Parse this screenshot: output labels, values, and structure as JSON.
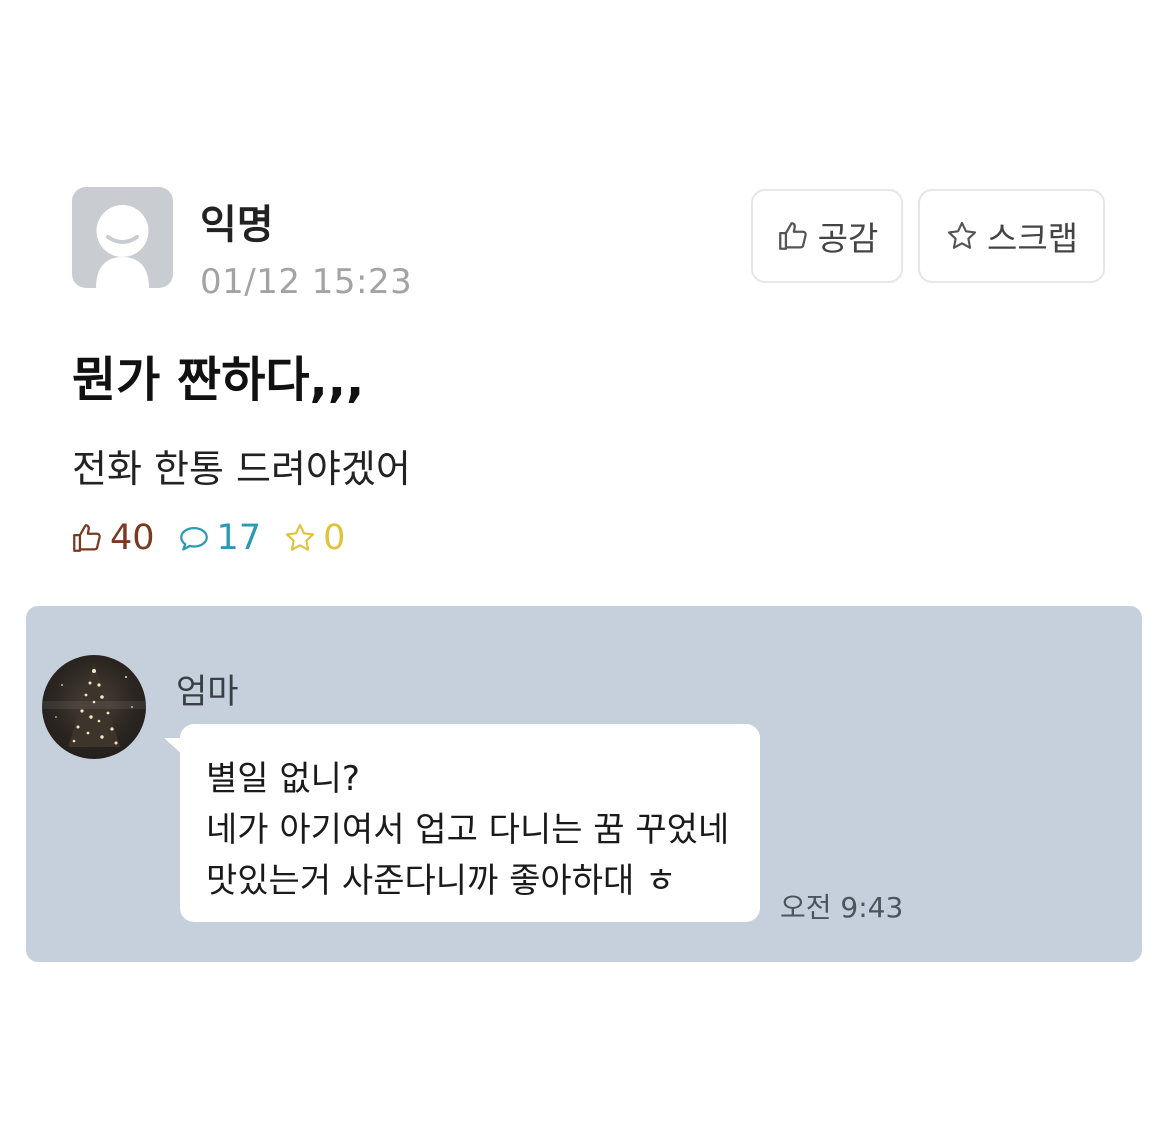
{
  "post": {
    "author": "익명",
    "timestamp": "01/12 15:23",
    "title": "뭔가 짠하다,,,",
    "body": "전화 한통 드려야겠어"
  },
  "actions": {
    "like_label": "공감",
    "scrap_label": "스크랩",
    "like_icon": "thumbs-up-icon",
    "scrap_icon": "star-icon"
  },
  "stats": {
    "likes": "40",
    "comments": "17",
    "scraps": "0",
    "colors": {
      "likes": "#7a3a22",
      "comments": "#2c9ab3",
      "scraps": "#e0c33b"
    }
  },
  "chat": {
    "sender": "엄마",
    "message_lines": [
      "별일 없니?",
      "네가 아기여서 업고 다니는 꿈 꾸었네",
      "맛있는거 사준다니까 좋아하대 ㅎ"
    ],
    "time": "오전 9:43",
    "background": "#c6d0dc"
  }
}
